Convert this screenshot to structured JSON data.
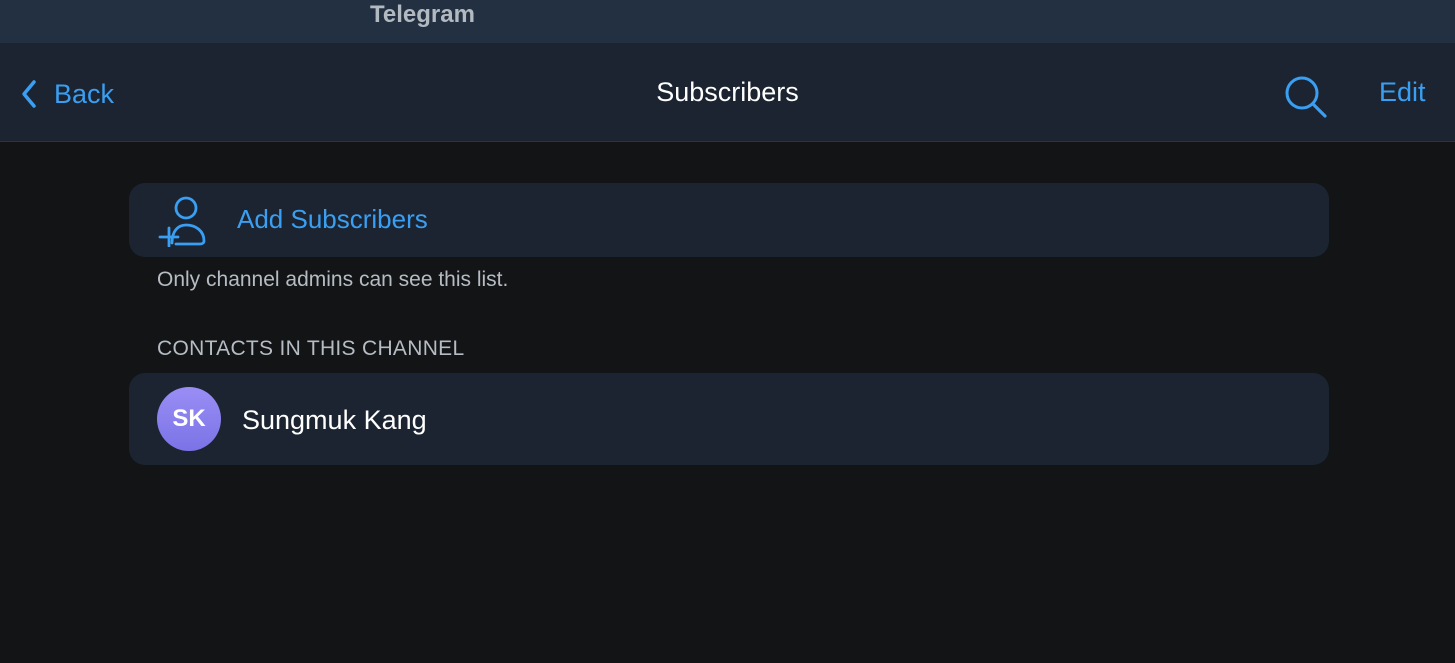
{
  "window": {
    "app_title": "Telegram"
  },
  "navbar": {
    "back_label": "Back",
    "title": "Subscribers",
    "search_icon": "search-icon",
    "edit_label": "Edit"
  },
  "add_subscribers": {
    "icon": "add-user-icon",
    "label": "Add Subscribers"
  },
  "note": "Only channel admins can see this list.",
  "contacts_section": {
    "header": "CONTACTS IN THIS CHANNEL",
    "contacts": [
      {
        "initials": "SK",
        "name": "Sungmuk Kang"
      }
    ]
  },
  "colors": {
    "accent": "#3a9ff2",
    "background": "#131416",
    "card": "#1b2430",
    "titlebar": "#223041",
    "avatar_gradient_top": "#9a8ef5",
    "avatar_gradient_bottom": "#7b73e6"
  }
}
